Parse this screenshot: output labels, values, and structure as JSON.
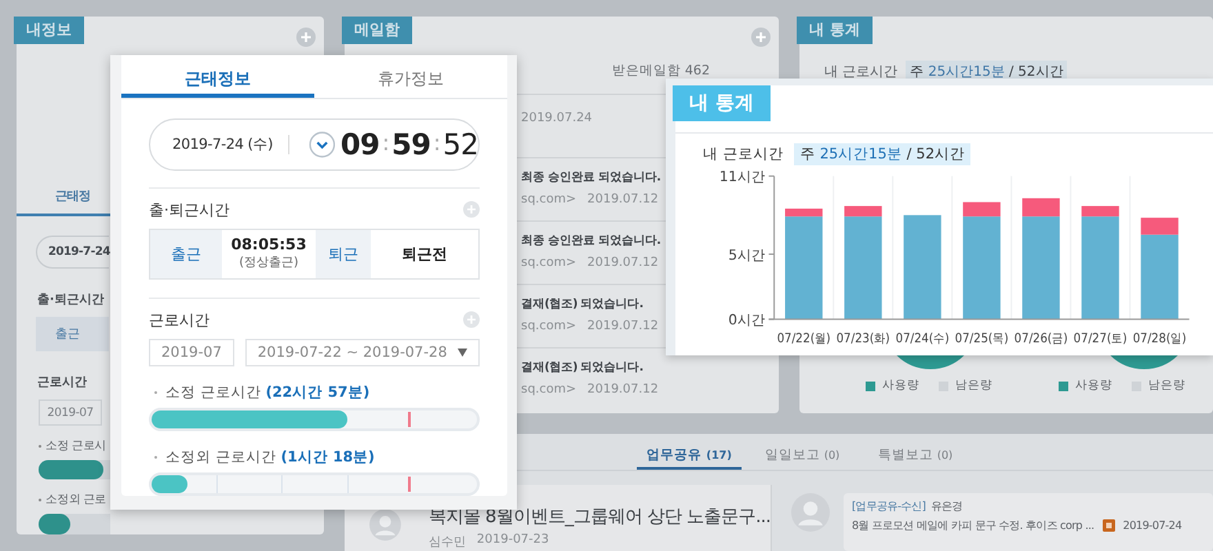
{
  "background": {
    "my_info": {
      "title": "내정보",
      "tab": "근태정",
      "date": "2019-7-24",
      "commute_title": "출·퇴근시간",
      "clock_in": "출근",
      "work_title": "근로시간",
      "month": "2019-07",
      "bars": [
        {
          "label": "소정 근로시",
          "level": 0.9
        },
        {
          "label": "소정외 근로",
          "level": 0.45
        }
      ]
    },
    "mail": {
      "title": "메일함",
      "inbox": "받은메일함 462",
      "rows": [
        {
          "date": "2019.07.24"
        },
        {
          "subject": "최종 승인완료 되었습니다.",
          "sender": "sq.com>",
          "date": "2019.07.12"
        },
        {
          "subject": "최종 승인완료 되었습니다.",
          "sender": "sq.com>",
          "date": "2019.07.12"
        },
        {
          "subject": "결재(협조) 되었습니다.",
          "sender": "sq.com>",
          "date": "2019.07.12"
        },
        {
          "subject": "결재(협조) 되었습니다.",
          "sender": "sq.com>",
          "date": "2019.07.12"
        }
      ]
    },
    "stats": {
      "title": "내 통계",
      "label": "내 근로시간",
      "summary": "주 **25시간15분** / 52시간",
      "legends": [
        [
          {
            "label": "사용량",
            "color": "#2e9a92"
          },
          {
            "label": "남은량",
            "color": "#cfd3d7"
          }
        ],
        [
          {
            "label": "사용량",
            "color": "#2e9a92"
          },
          {
            "label": "남은량",
            "color": "#cfd3d7"
          }
        ]
      ]
    },
    "work": {
      "tabs": [
        {
          "label": "업무공유",
          "count": "(17)",
          "selected": true
        },
        {
          "label": "일일보고",
          "count": "(0)",
          "selected": false
        },
        {
          "label": "특별보고",
          "count": "(0)",
          "selected": false
        }
      ],
      "post": {
        "title": "복지몰 8월이벤트_그룹웨어 상단 노출문구...",
        "author": "심수민",
        "date": "2019-07-23"
      },
      "feed": {
        "tag": "[업무공유-수신]",
        "name": "유은경",
        "text": "8월 프로모션 메일에 카피 문구 수정. 후이즈 corp ...",
        "date": "2019-07-24"
      }
    }
  },
  "attendance_popup": {
    "tabs": [
      {
        "label": "근태정보",
        "selected": true
      },
      {
        "label": "휴가정보",
        "selected": false
      }
    ],
    "date": "2019-7-24 (수)",
    "time": [
      "09",
      "59",
      "52"
    ],
    "time_separator": ":",
    "commute": {
      "title": "출·퇴근시간",
      "in_label": "출근",
      "in_time": "08:05:53",
      "in_status": "(정상출근)",
      "out_label": "퇴근",
      "out_status": "퇴근전"
    },
    "work": {
      "title": "근로시간",
      "month": "2019-07",
      "range": "2019-07-22 ~ 2019-07-28",
      "bars": [
        {
          "kind": "solid",
          "label": "소정 근로시간 **(22시간 57분)**",
          "level": 0.6
        },
        {
          "kind": "segmented",
          "label": "소정외 근로시간 **(1시간 18분)**",
          "level": 0.11
        }
      ]
    }
  },
  "stats_popup": {
    "title": "내 통계",
    "label": "내 근로시간",
    "summary": "주 **25시간15분** / 52시간",
    "chart_data": {
      "type": "bar",
      "stacked": true,
      "categories": [
        "07/22(월)",
        "07/23(화)",
        "07/24(수)",
        "07/25(목)",
        "07/26(금)",
        "07/27(토)",
        "07/28(일)"
      ],
      "series": [
        {
          "color": "#62b2d2",
          "values": [
            7.9,
            7.9,
            8.0,
            7.9,
            7.9,
            7.9,
            6.5
          ]
        },
        {
          "color": "#f65a7c",
          "values": [
            0.6,
            0.8,
            0,
            1.1,
            1.4,
            0.8,
            1.3
          ]
        }
      ],
      "ylim": [
        0,
        11
      ],
      "yticks": [
        {
          "value": 0,
          "label": "0시간"
        },
        {
          "value": 5,
          "label": "5시간"
        },
        {
          "value": 11,
          "label": "11시간"
        }
      ]
    }
  }
}
